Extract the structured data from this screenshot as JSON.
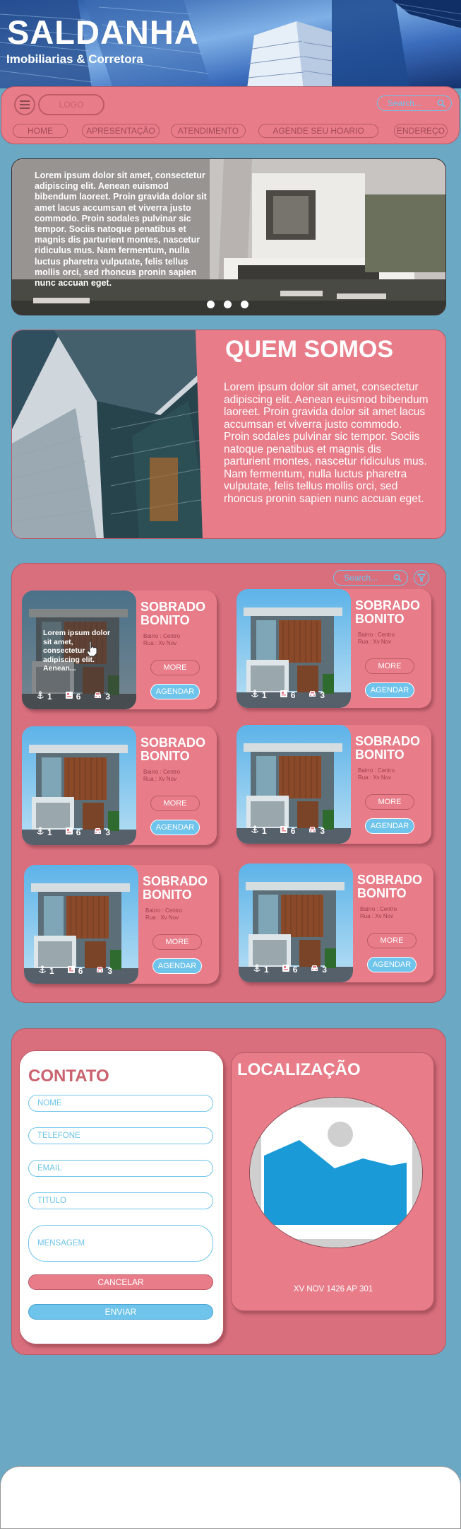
{
  "header": {
    "title": "SALDANHA",
    "subtitle": "Imobiliarias & Corretora"
  },
  "nav": {
    "logo": "LOGO",
    "search_placeholder": "Search...",
    "links": [
      "HOME",
      "APRESENTAÇÃO",
      "ATENDIMENTO",
      "AGENDE SEU HOARIO",
      "ENDEREÇO"
    ]
  },
  "hero": {
    "text": "Lorem ipsum dolor sit amet, consectetur adipiscing elit. Aenean euismod bibendum laoreet. Proin gravida dolor sit amet lacus accumsan et viverra justo commodo. Proin sodales pulvinar sic tempor. Sociis natoque penatibus et magnis dis parturient montes, nascetur ridiculus mus. Nam fermentum, nulla luctus pharetra vulputate, felis tellus mollis orci, sed rhoncus pronin sapien nunc accuan eget."
  },
  "about": {
    "title": "QUEM SOMOS",
    "text": "Lorem ipsum dolor sit amet, consectetur adipiscing elit. Aenean euismod bibendum laoreet. Proin gravida dolor sit amet lacus accumsan et viverra justo commodo. Proin sodales pulvinar sic tempor. Sociis natoque penatibus et magnis dis parturient montes, nascetur ridiculus mus. Nam fermentum, nulla luctus pharetra vulputate, felis tellus mollis orci, sed rhoncus pronin sapien nunc accuan eget."
  },
  "listings": {
    "search_placeholder": "Search...",
    "hover_text": "Lorem ipsum dolor sit amet, consectetur adipiscing elit. Aenean...",
    "cards": [
      {
        "title": "SOBRADO BONITO",
        "bairro": "Bairro : Centro",
        "rua": "Rua : Xv Nov",
        "more": "MORE",
        "agendar": "AGENDAR",
        "baths": "1",
        "beds": "6",
        "cars": "3"
      },
      {
        "title": "SOBRADO BONITO",
        "bairro": "Bairro : Centro",
        "rua": "Rua : Xv Nov",
        "more": "MORE",
        "agendar": "AGENDAR",
        "baths": "1",
        "beds": "6",
        "cars": "3"
      },
      {
        "title": "SOBRADO BONITO",
        "bairro": "Bairro : Centro",
        "rua": "Rua : Xv Nov",
        "more": "MORE",
        "agendar": "AGENDAR",
        "baths": "1",
        "beds": "6",
        "cars": "3"
      },
      {
        "title": "SOBRADO BONITO",
        "bairro": "Bairro : Centro",
        "rua": "Rua : Xv Nov",
        "more": "MORE",
        "agendar": "AGENDAR",
        "baths": "1",
        "beds": "6",
        "cars": "3"
      },
      {
        "title": "SOBRADO BONITO",
        "bairro": "Bairro : Centro",
        "rua": "Rua : Xv Nov",
        "more": "MORE",
        "agendar": "AGENDAR",
        "baths": "1",
        "beds": "6",
        "cars": "3"
      },
      {
        "title": "SOBRADO BONITO",
        "bairro": "Bairro : Centro",
        "rua": "Rua : Xv Nov",
        "more": "MORE",
        "agendar": "AGENDAR",
        "baths": "1",
        "beds": "6",
        "cars": "3"
      }
    ]
  },
  "contact": {
    "title": "CONTATO",
    "fields": {
      "nome": "NOME",
      "telefone": "TELEFONE",
      "email": "EMAIL",
      "titulo": "TITULO",
      "mensagem": "MENSAGEM"
    },
    "cancel_label": "CANCELAR",
    "send_label": "ENVIAR"
  },
  "location": {
    "title": "LOCALIZAÇÃO",
    "address": "XV NOV 1426 AP 301"
  },
  "colors": {
    "pink": "#e87c89",
    "dark_pink": "#d96f7d",
    "blue_accent": "#6fc4ec",
    "background": "#6aa8c4"
  }
}
